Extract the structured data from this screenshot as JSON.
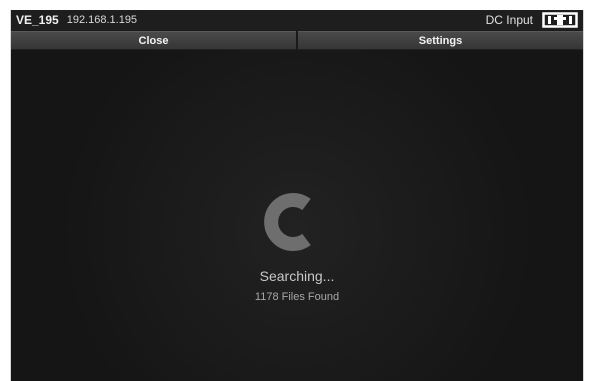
{
  "header": {
    "device_name": "VE_195",
    "ip_address": "192.168.1.195",
    "power_status": "DC Input",
    "power_icon": "dc-power-plug-icon"
  },
  "toolbar": {
    "close_label": "Close",
    "settings_label": "Settings"
  },
  "main": {
    "status": "Searching...",
    "files_found": "1178 Files Found",
    "spinner_icon": "loading-spinner-icon"
  },
  "colors": {
    "background": "#1a1a1a",
    "button": "#404040",
    "text": "#f0f0f0",
    "spinner": "#6e6e6e"
  }
}
